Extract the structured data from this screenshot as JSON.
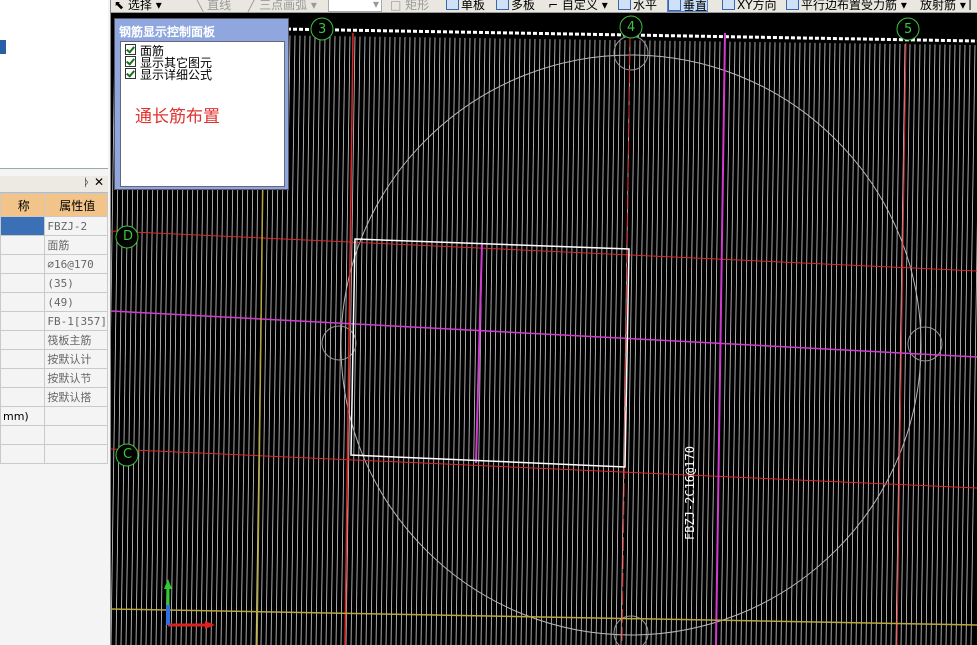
{
  "toolbar": {
    "select": "选择",
    "line": "直线",
    "three_point_arc": "三点画弧",
    "rect": "矩形",
    "single_board": "单板",
    "multi_board": "多板",
    "custom": "自定义",
    "horizontal": "水平",
    "vertical": "垂直",
    "xy_direction": "XY方向",
    "parallel_edge": "平行边布置受力筋",
    "radial_rebar": "放射筋"
  },
  "property_panel": {
    "col_name": "称",
    "col_value": "属性值",
    "rows": [
      {
        "name": "",
        "value": "FBZJ-2"
      },
      {
        "name": "",
        "value": "面筋"
      },
      {
        "name": "",
        "value": "⌀16@170"
      },
      {
        "name": "",
        "value": "(35)"
      },
      {
        "name": "",
        "value": "(49)"
      },
      {
        "name": "",
        "value": "FB-1[357]"
      },
      {
        "name": "",
        "value": "筏板主筋"
      },
      {
        "name": "",
        "value": "按默认计"
      },
      {
        "name": "",
        "value": "按默认节"
      },
      {
        "name": "",
        "value": "按默认搭"
      },
      {
        "name": "mm)",
        "value": ""
      },
      {
        "name": "",
        "value": ""
      },
      {
        "name": "",
        "value": ""
      }
    ]
  },
  "control_panel": {
    "title": "钢筋显示控制面板",
    "options": [
      "面筋",
      "显示其它图元",
      "显示详细公式"
    ],
    "mode_text": "通长筋布置"
  },
  "canvas": {
    "axis_labels": {
      "axis_3": "3",
      "axis_4": "4",
      "axis_5": "5",
      "axis_D": "D",
      "axis_C": "C"
    },
    "rebar_label": "FBZJ-2C16@170",
    "colors": {
      "background": "#000000",
      "rebar": "#ffffff",
      "grid": "#e02828",
      "beam": "#d23cd2",
      "axis_label": "#3cc43c"
    }
  }
}
